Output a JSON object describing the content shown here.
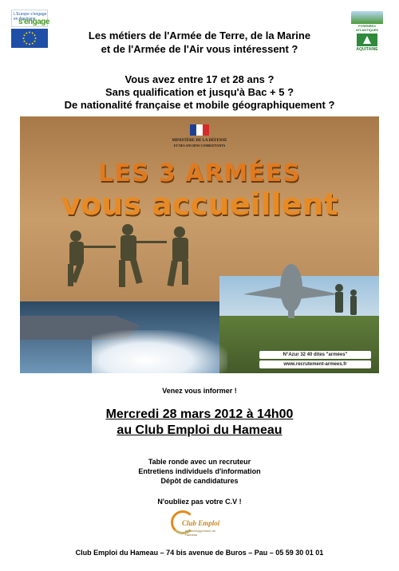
{
  "header": {
    "eu_logo_text": "L'Europe s'engage en Aquitaine",
    "eu_logo_short": "s'engage",
    "region_logo_top": "PYRÉNÉES ATLANTIQUES",
    "region_logo_name": "AQUITAINE",
    "line1": "Les métiers de l'Armée de Terre, de la Marine",
    "line2": "et de l'Armée de l'Air vous intéressent ?"
  },
  "questions": {
    "q1": "Vous avez entre 17 et 28 ans ?",
    "q2": "Sans qualification et jusqu'à Bac + 5 ?",
    "q3": "De nationalité française et mobile géographiquement ?"
  },
  "poster": {
    "ministry_line1": "MINISTÈRE DE LA DÉFENSE",
    "ministry_line2": "ET DES ANCIENS COMBATTANTS",
    "title_line1": "LES 3 ARMÉES",
    "title_line2": "vous accueillent",
    "phone": "N°Azur 32 40 dites \"armées\"",
    "website": "www.recrutement-armees.fr",
    "flag_colors": [
      "#1f3f95",
      "#ffffff",
      "#d62b2b"
    ]
  },
  "invite": "Venez vous informer !",
  "event": {
    "date_line": "Mercredi 28 mars 2012 à 14h00",
    "place_line": "au Club Emploi du Hameau"
  },
  "activities": [
    "Table ronde avec un recruteur",
    "Entretiens individuels d'information",
    "Dépôt de candidatures"
  ],
  "reminder": "N'oubliez pas votre C.V !",
  "club_logo": {
    "name": "Club Emploi",
    "subtitle": "et Développement du Hameau"
  },
  "footer": "Club Emploi du Hameau – 74 bis avenue de Buros – Pau – 05 59 30 01 01"
}
